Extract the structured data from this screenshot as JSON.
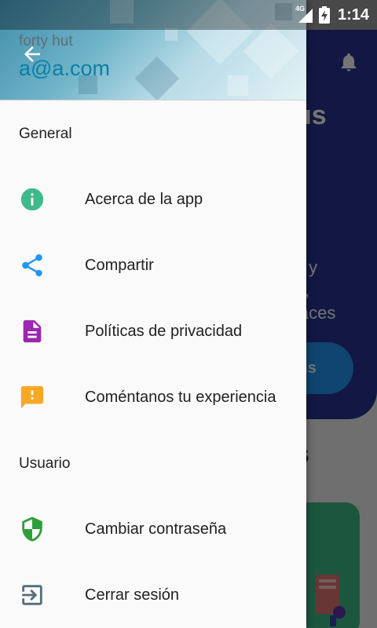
{
  "status_bar": {
    "network": "4G",
    "time": "1:14"
  },
  "background": {
    "hero_title": "us",
    "hero_text": [
      "s y",
      "o,",
      "laces"
    ],
    "hero_button": "ms",
    "section_title": "s"
  },
  "drawer": {
    "header": {
      "name": "forty hut",
      "email": "a@a.com"
    },
    "sections": [
      {
        "title": "General",
        "items": [
          {
            "label": "Acerca de la app",
            "icon": "info-icon",
            "color": "#3dbb8a"
          },
          {
            "label": "Compartir",
            "icon": "share-icon",
            "color": "#2196f3"
          },
          {
            "label": "Políticas de privacidad",
            "icon": "document-icon",
            "color": "#9c27b0"
          },
          {
            "label": "Coméntanos tu experiencia",
            "icon": "feedback-icon",
            "color": "#f9a825"
          }
        ]
      },
      {
        "title": "Usuario",
        "items": [
          {
            "label": "Cambiar contraseña",
            "icon": "shield-icon",
            "color": "#2e9e3a"
          },
          {
            "label": "Cerrar sesión",
            "icon": "logout-icon",
            "color": "#546e7a"
          }
        ]
      }
    ]
  }
}
